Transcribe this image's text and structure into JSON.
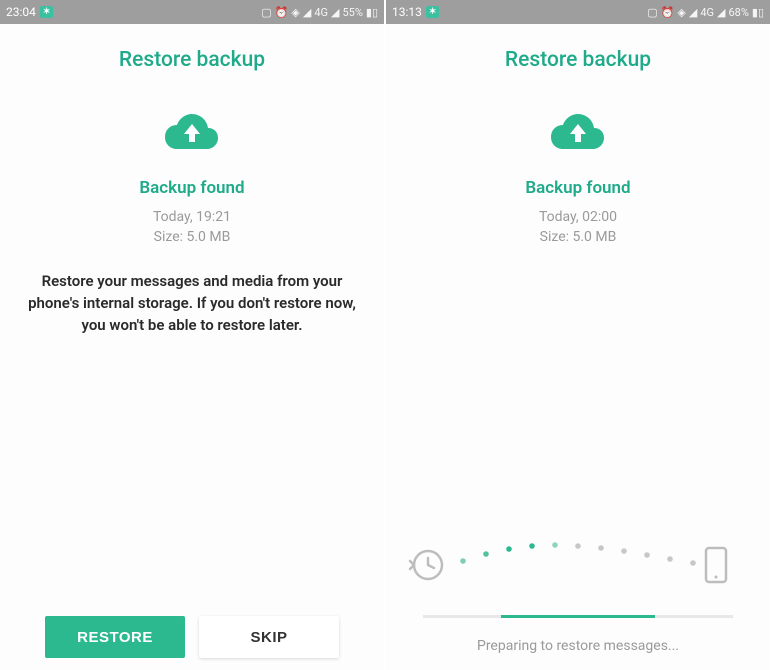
{
  "left": {
    "status": {
      "time": "23:04",
      "network_label": "4G",
      "battery_pct": "55%"
    },
    "title": "Restore backup",
    "backup": {
      "heading": "Backup found",
      "timestamp": "Today, 19:21",
      "size": "Size: 5.0 MB"
    },
    "description": "Restore your messages and media from your phone's internal storage. If you don't restore now, you won't be able to restore later.",
    "buttons": {
      "restore": "RESTORE",
      "skip": "SKIP"
    }
  },
  "right": {
    "status": {
      "time": "13:13",
      "network_label": "4G",
      "battery_pct": "68%"
    },
    "title": "Restore backup",
    "backup": {
      "heading": "Backup found",
      "timestamp": "Today, 02:00",
      "size": "Size: 5.0 MB"
    },
    "progress_text": "Preparing to restore messages..."
  },
  "colors": {
    "accent": "#1fab8a",
    "button_primary": "#2cb990",
    "muted": "#9a9a9a"
  }
}
